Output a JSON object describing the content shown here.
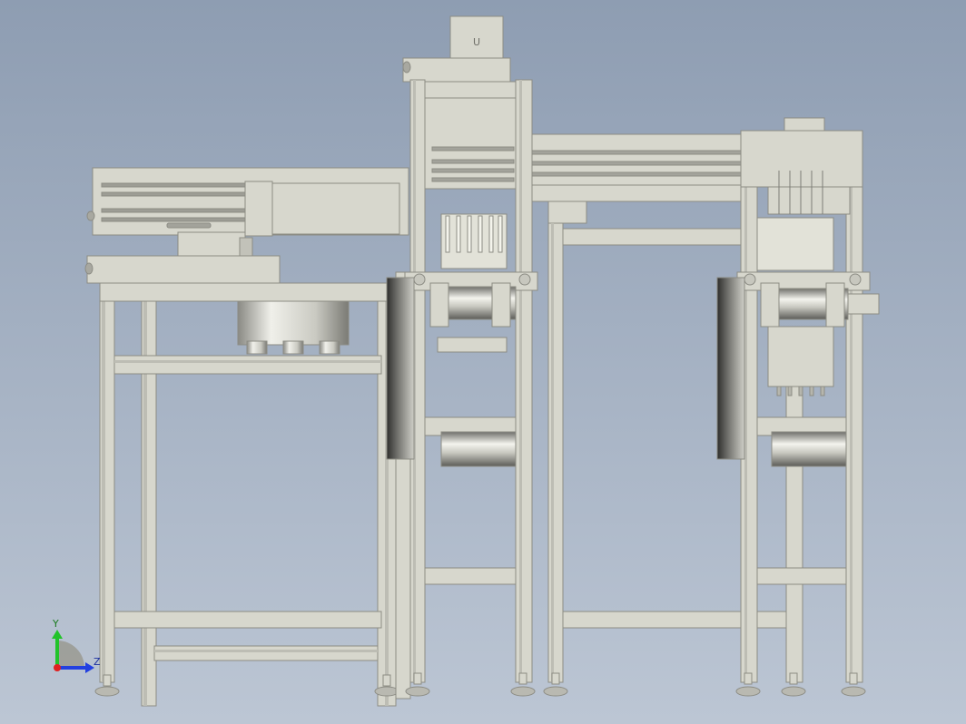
{
  "viewport": {
    "background_top": "#8e9db2",
    "background_bottom": "#bcc6d4"
  },
  "triad": {
    "y_label": "Y",
    "z_label": "Z",
    "y_color": "#22c32a",
    "z_color": "#2340e0",
    "origin_color": "#e02020"
  },
  "model": {
    "frame_color": "#d7d7cd",
    "panel_color": "#d3d3c9",
    "edge_color": "#8c8c84",
    "bolt_mark": "U"
  }
}
